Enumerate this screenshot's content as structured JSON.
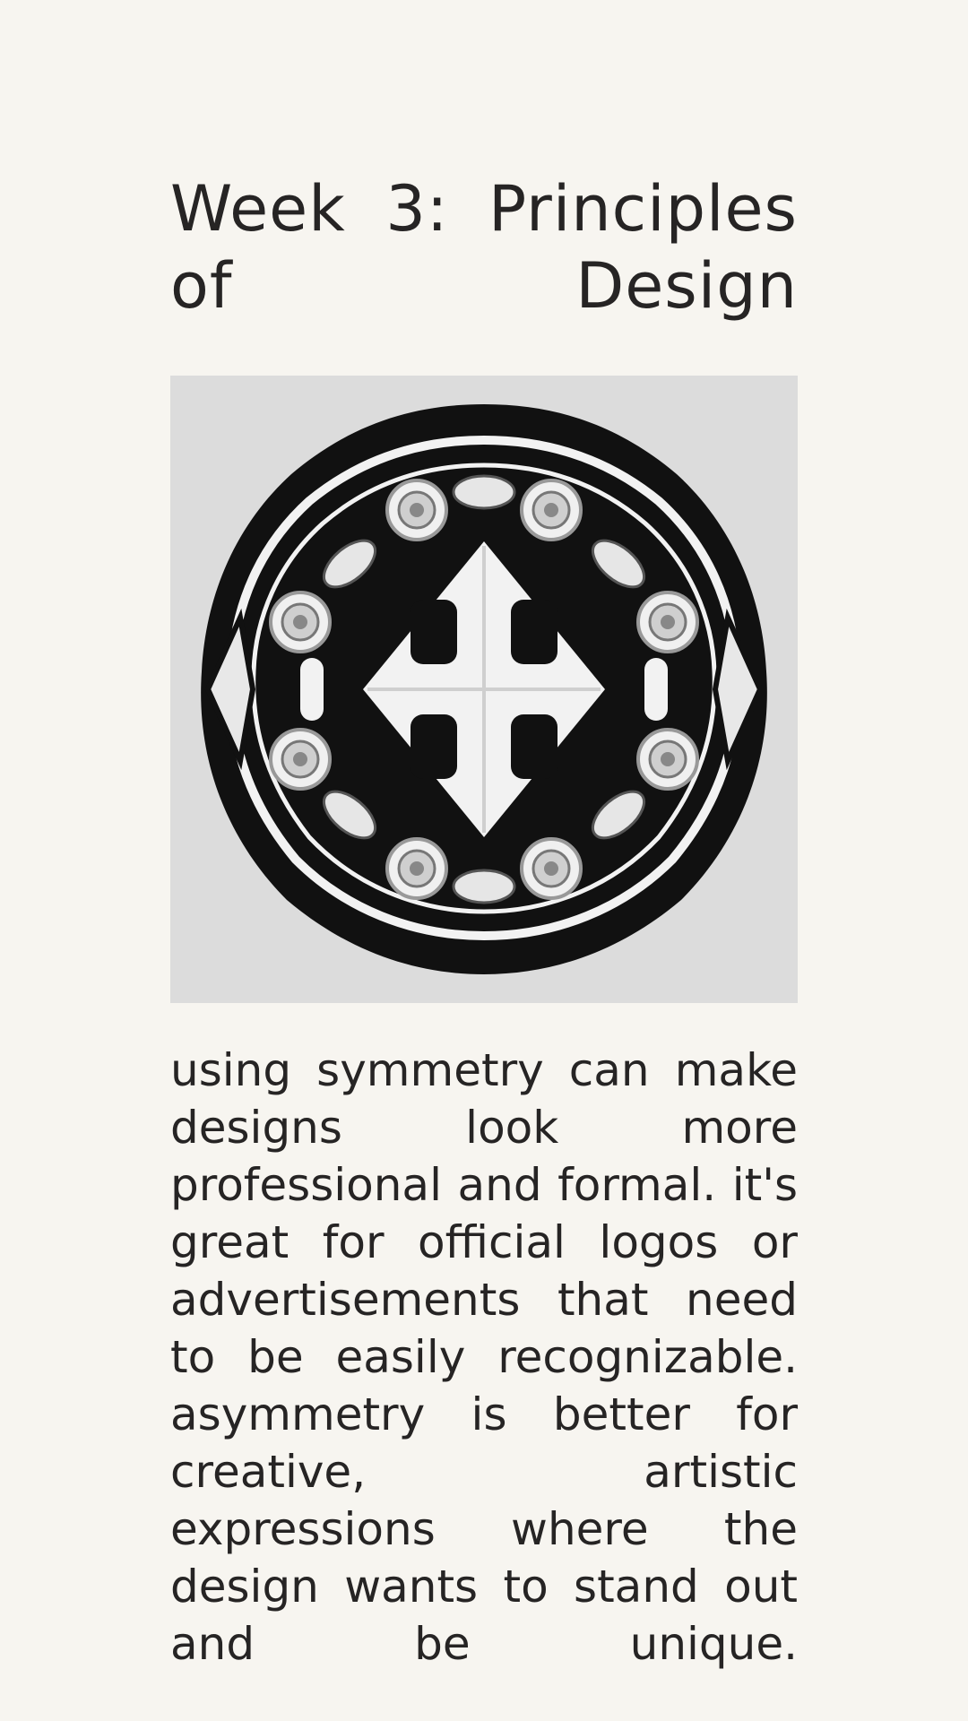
{
  "page": {
    "background_color": "#f7f5f0",
    "text_color": "#262424"
  },
  "heading": {
    "title": "Week 3: Principles of Design"
  },
  "figure": {
    "background_color": "#dcdcdc",
    "motif_color": "#111111",
    "accent_color": "#f0f0f0"
  },
  "article": {
    "body": "using symmetry can make designs look more professional and formal. it's great for official logos or advertisements that need to be easily recognizable. asymmetry is better for creative, artistic expressions where the design wants to stand out and be unique."
  }
}
